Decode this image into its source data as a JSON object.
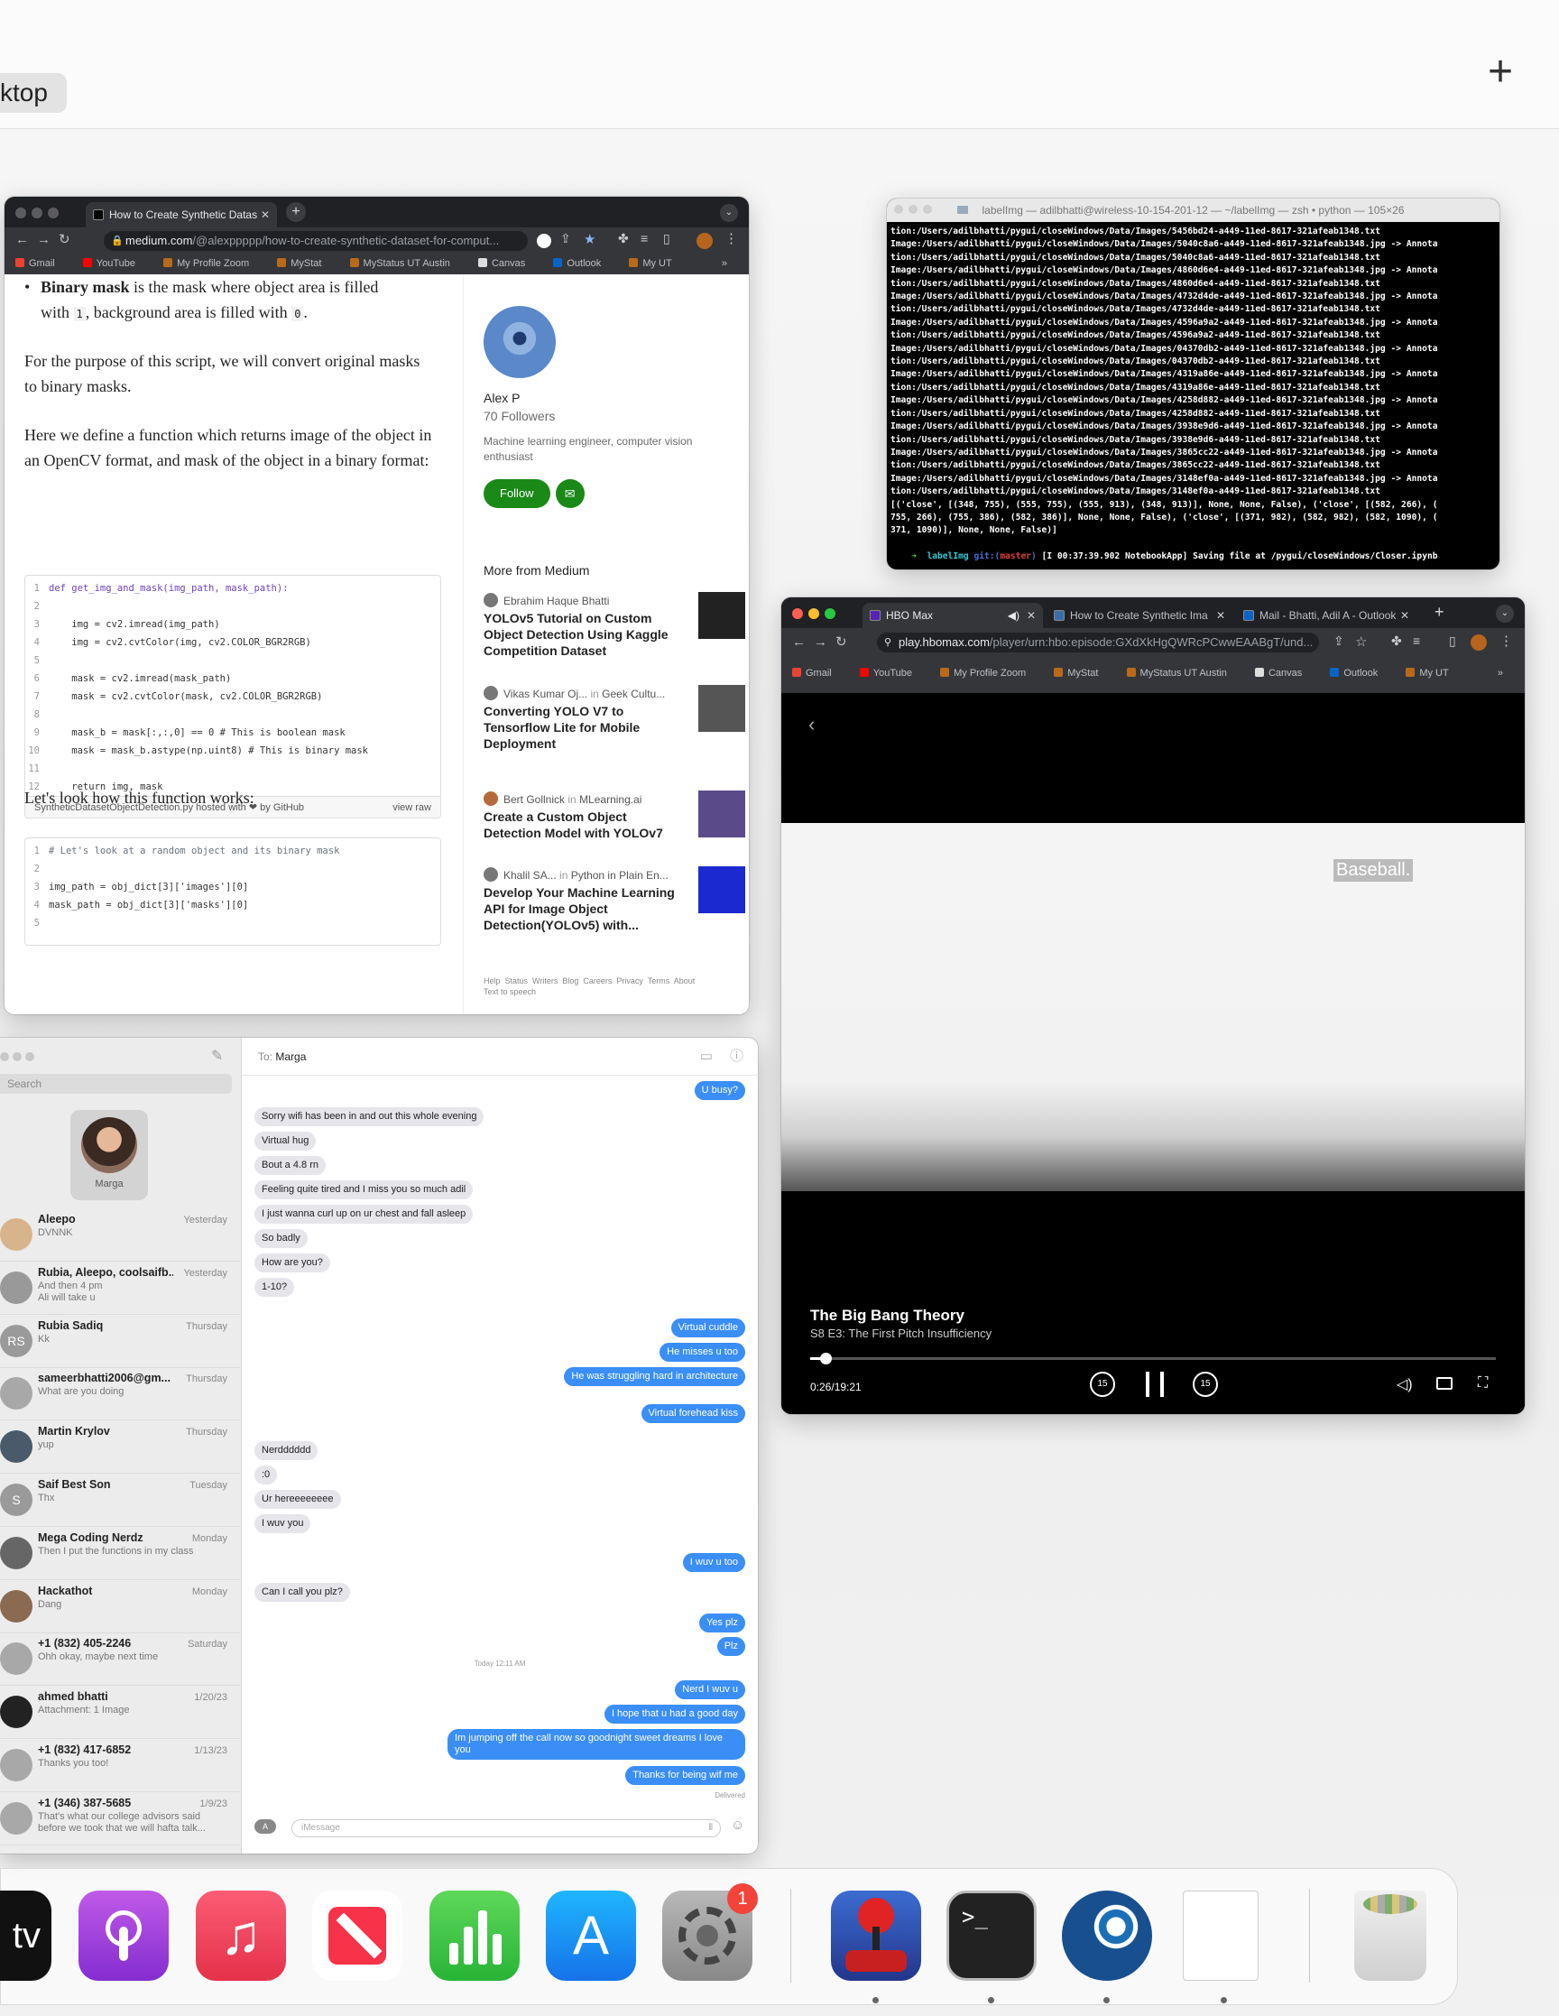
{
  "mission_control": {
    "desktop_label": "ktop",
    "add_space": "+"
  },
  "medium_window": {
    "tab_title": "How to Create Synthetic Datas",
    "url_main": "medium.com",
    "url_rest": "/@alexppppp/how-to-create-synthetic-dataset-for-comput...",
    "bookmarks": [
      "Gmail",
      "YouTube",
      "My Profile Zoom",
      "MyStat",
      "MyStatus UT Austin",
      "Canvas",
      "Outlook",
      "My UT"
    ],
    "bullet_bold": "Binary mask",
    "bullet_text1": " is the mask where object area is filled",
    "bullet_text2_a": "with ",
    "code_one": "1",
    "bullet_text2_b": ", background area is filled with ",
    "code_zero": "0",
    "para1": "For the purpose of this script, we will convert original masks to binary masks.",
    "para2": "Here we define a function which returns image of the object in an OpenCV format, and mask of the object in a binary format:",
    "code_block1": [
      {
        "n": "1",
        "t": "def get_img_and_mask(img_path, mask_path):"
      },
      {
        "n": "2",
        "t": ""
      },
      {
        "n": "3",
        "t": "    img = cv2.imread(img_path)"
      },
      {
        "n": "4",
        "t": "    img = cv2.cvtColor(img, cv2.COLOR_BGR2RGB)"
      },
      {
        "n": "5",
        "t": ""
      },
      {
        "n": "6",
        "t": "    mask = cv2.imread(mask_path)"
      },
      {
        "n": "7",
        "t": "    mask = cv2.cvtColor(mask, cv2.COLOR_BGR2RGB)"
      },
      {
        "n": "8",
        "t": ""
      },
      {
        "n": "9",
        "t": "    mask_b = mask[:,:,0] == 0 # This is boolean mask"
      },
      {
        "n": "10",
        "t": "    mask = mask_b.astype(np.uint8) # This is binary mask"
      },
      {
        "n": "11",
        "t": ""
      },
      {
        "n": "12",
        "t": "    return img, mask"
      }
    ],
    "gist_file": "SyntheticDatasetObjectDetection.py",
    "gist_hosted": " hosted with ❤ by ",
    "gist_github": "GitHub",
    "gist_view_raw": "view raw",
    "para3": "Let's look how this function works:",
    "code_block2": [
      {
        "n": "1",
        "t": "# Let's look at a random object and its binary mask"
      },
      {
        "n": "2",
        "t": ""
      },
      {
        "n": "3",
        "t": "img_path = obj_dict[3]['images'][0]"
      },
      {
        "n": "4",
        "t": "mask_path = obj_dict[3]['masks'][0]"
      },
      {
        "n": "5",
        "t": ""
      }
    ],
    "author_name": "Alex P",
    "author_followers": "70 Followers",
    "author_bio": "Machine learning engineer, computer vision enthusiast",
    "follow_label": "Follow",
    "more_heading": "More from Medium",
    "more": [
      {
        "author": "Ebrahim Haque Bhatti",
        "pub": "",
        "title": "YOLOv5 Tutorial on Custom Object Detection Using Kaggle Competition Dataset"
      },
      {
        "author": "Vikas Kumar Oj...",
        "pub": "Geek Cultu...",
        "title": "Converting YOLO V7 to Tensorflow Lite for Mobile Deployment"
      },
      {
        "author": "Bert Gollnick",
        "pub": "MLearning.ai",
        "title": "Create a Custom Object Detection Model with YOLOv7"
      },
      {
        "author": "Khalil SA...",
        "pub": "Python in Plain En...",
        "title": "Develop Your Machine Learning API for Image Object Detection(YOLOv5) with..."
      }
    ],
    "in_label": "in",
    "footer_links": "Help  Status  Writers  Blog  Careers  Privacy  Terms  About",
    "footer_links2": "Text to speech"
  },
  "terminal_window": {
    "title": "labelImg — adilbhatti@wireless-10-154-201-12 — ~/labelImg — zsh • python — 105×26",
    "lines": [
      "tion:/Users/adilbhatti/pygui/closeWindows/Data/Images/5456bd24-a449-11ed-8617-321afeab1348.txt",
      "Image:/Users/adilbhatti/pygui/closeWindows/Data/Images/5040c8a6-a449-11ed-8617-321afeab1348.jpg -> Annota",
      "tion:/Users/adilbhatti/pygui/closeWindows/Data/Images/5040c8a6-a449-11ed-8617-321afeab1348.txt",
      "Image:/Users/adilbhatti/pygui/closeWindows/Data/Images/4860d6e4-a449-11ed-8617-321afeab1348.jpg -> Annota",
      "tion:/Users/adilbhatti/pygui/closeWindows/Data/Images/4860d6e4-a449-11ed-8617-321afeab1348.txt",
      "Image:/Users/adilbhatti/pygui/closeWindows/Data/Images/4732d4de-a449-11ed-8617-321afeab1348.jpg -> Annota",
      "tion:/Users/adilbhatti/pygui/closeWindows/Data/Images/4732d4de-a449-11ed-8617-321afeab1348.txt",
      "Image:/Users/adilbhatti/pygui/closeWindows/Data/Images/4596a9a2-a449-11ed-8617-321afeab1348.jpg -> Annota",
      "tion:/Users/adilbhatti/pygui/closeWindows/Data/Images/4596a9a2-a449-11ed-8617-321afeab1348.txt",
      "Image:/Users/adilbhatti/pygui/closeWindows/Data/Images/04370db2-a449-11ed-8617-321afeab1348.jpg -> Annota",
      "tion:/Users/adilbhatti/pygui/closeWindows/Data/Images/04370db2-a449-11ed-8617-321afeab1348.txt",
      "Image:/Users/adilbhatti/pygui/closeWindows/Data/Images/4319a86e-a449-11ed-8617-321afeab1348.jpg -> Annota",
      "tion:/Users/adilbhatti/pygui/closeWindows/Data/Images/4319a86e-a449-11ed-8617-321afeab1348.txt",
      "Image:/Users/adilbhatti/pygui/closeWindows/Data/Images/4258d882-a449-11ed-8617-321afeab1348.jpg -> Annota",
      "tion:/Users/adilbhatti/pygui/closeWindows/Data/Images/4258d882-a449-11ed-8617-321afeab1348.txt",
      "Image:/Users/adilbhatti/pygui/closeWindows/Data/Images/3938e9d6-a449-11ed-8617-321afeab1348.jpg -> Annota",
      "tion:/Users/adilbhatti/pygui/closeWindows/Data/Images/3938e9d6-a449-11ed-8617-321afeab1348.txt",
      "Image:/Users/adilbhatti/pygui/closeWindows/Data/Images/3865cc22-a449-11ed-8617-321afeab1348.jpg -> Annota",
      "tion:/Users/adilbhatti/pygui/closeWindows/Data/Images/3865cc22-a449-11ed-8617-321afeab1348.txt",
      "Image:/Users/adilbhatti/pygui/closeWindows/Data/Images/3148ef0a-a449-11ed-8617-321afeab1348.jpg -> Annota",
      "tion:/Users/adilbhatti/pygui/closeWindows/Data/Images/3148ef0a-a449-11ed-8617-321afeab1348.txt",
      "[('close', [(348, 755), (555, 755), (555, 913), (348, 913)], None, None, False), ('close', [(582, 266), (",
      "755, 266), (755, 386), (582, 386)], None, None, False), ('close', [(371, 982), (582, 982), (582, 1090), (",
      "371, 1090)], None, None, False)]"
    ],
    "prompt_arrow": "➜",
    "prompt_dir": "labelImg",
    "prompt_git": "git:(",
    "prompt_branch": "master",
    "prompt_git_end": ")",
    "prompt_rest": "[I 00:37:39.902 NotebookApp] Saving file at /pygui/closeWindows/Closer.ipynb"
  },
  "hbo_window": {
    "tabs": [
      "HBO Max",
      "How to Create Synthetic Ima",
      "Mail - Bhatti, Adil A - Outlook"
    ],
    "url_main": "play.hbomax.com",
    "url_rest": "/player/urn:hbo:episode:GXdXkHgQWRcPCwwEAABgT/und...",
    "bookmarks": [
      "Gmail",
      "YouTube",
      "My Profile Zoom",
      "MyStat",
      "MyStatus UT Austin",
      "Canvas",
      "Outlook",
      "My UT"
    ],
    "subtitle_caption": "Baseball.",
    "show_title": "The Big Bang Theory",
    "episode": "S8 E3: The First Pitch Insufficiency",
    "time": "0:26/19:21",
    "progress": 0.022,
    "skip_back": "15",
    "skip_fwd": "15"
  },
  "messages_window": {
    "search_placeholder": "Search",
    "pinned_name": "Marga",
    "to_label": "To:",
    "to_name": "Marga",
    "conversations": [
      {
        "initials": "",
        "name": "Aleepo",
        "date": "Yesterday",
        "preview": "DVNNK",
        "preview2": ""
      },
      {
        "initials": "",
        "name": "Rubia, Aleepo, coolsaifb...",
        "date": "Yesterday",
        "preview": "And then 4 pm",
        "preview2": "Ali will take u"
      },
      {
        "initials": "RS",
        "name": "Rubia Sadiq",
        "date": "Thursday",
        "preview": "Kk",
        "preview2": ""
      },
      {
        "initials": "",
        "name": "sameerbhatti2006@gm...",
        "date": "Thursday",
        "preview": "What are you doing",
        "preview2": ""
      },
      {
        "initials": "",
        "name": "Martin Krylov",
        "date": "Thursday",
        "preview": "yup",
        "preview2": ""
      },
      {
        "initials": "S",
        "name": "Saif Best Son",
        "date": "Tuesday",
        "preview": "Thx",
        "preview2": ""
      },
      {
        "initials": "",
        "name": "Mega Coding Nerdz",
        "date": "Monday",
        "preview": "Then I put the functions in my class",
        "preview2": ""
      },
      {
        "initials": "",
        "name": "Hackathot",
        "date": "Monday",
        "preview": "Dang",
        "preview2": ""
      },
      {
        "initials": "",
        "name": "+1 (832) 405-2246",
        "date": "Saturday",
        "preview": "Ohh okay, maybe next time",
        "preview2": ""
      },
      {
        "initials": "",
        "name": "ahmed bhatti",
        "date": "1/20/23",
        "preview": "Attachment: 1 Image",
        "preview2": ""
      },
      {
        "initials": "",
        "name": "+1 (832) 417-6852",
        "date": "1/13/23",
        "preview": "Thanks you too!",
        "preview2": ""
      },
      {
        "initials": "",
        "name": "+1 (346) 387-5685",
        "date": "1/9/23",
        "preview": "That's what our college advisors said",
        "preview2": "before we took that we will hafta talk..."
      }
    ],
    "bubbles": [
      {
        "dir": "out",
        "text": "U busy?"
      },
      {
        "dir": "in",
        "text": "Sorry wifi has been in and out this whole evening"
      },
      {
        "dir": "in",
        "text": "Virtual hug"
      },
      {
        "dir": "in",
        "text": "Bout a 4.8 rn"
      },
      {
        "dir": "in",
        "text": "Feeling quite tired and I miss you so much adil"
      },
      {
        "dir": "in",
        "text": "I just wanna curl up on ur chest and fall asleep"
      },
      {
        "dir": "in",
        "text": "So badly"
      },
      {
        "dir": "in",
        "text": "How are you?"
      },
      {
        "dir": "in",
        "text": "1-10?"
      },
      {
        "dir": "out",
        "text": "Virtual cuddle"
      },
      {
        "dir": "out",
        "text": "He misses u too"
      },
      {
        "dir": "out",
        "text": "He was struggling hard in architecture"
      },
      {
        "dir": "out",
        "text": "Virtual forehead kiss"
      },
      {
        "dir": "in",
        "text": "Nerdddddd"
      },
      {
        "dir": "in",
        "text": ":0"
      },
      {
        "dir": "in",
        "text": "Ur hereeeeeeee"
      },
      {
        "dir": "in",
        "text": "I wuv you"
      },
      {
        "dir": "out",
        "text": "I wuv u too"
      },
      {
        "dir": "in",
        "text": "Can I call you plz?"
      },
      {
        "dir": "out",
        "text": "Yes plz"
      },
      {
        "dir": "out",
        "text": "Plz"
      },
      {
        "dir": "out",
        "text": "Nerd I wuv u"
      },
      {
        "dir": "out",
        "text": "I hope that u had a good day"
      },
      {
        "dir": "out",
        "text": "Im jumping off the call now so goodnight sweet dreams I love you"
      },
      {
        "dir": "out",
        "text": "Thanks for being wif me"
      }
    ],
    "timestamp": "Today 12:11 AM",
    "delivered": "Delivered",
    "input_placeholder": "iMessage"
  },
  "dock": {
    "apps": [
      "tv-icon",
      "podcasts-icon",
      "music-icon",
      "news-icon",
      "numbers-icon",
      "app-store-icon",
      "system-settings-icon",
      "joystick-app-icon",
      "terminal-icon",
      "steam-icon",
      "document-icon",
      "trash-icon"
    ],
    "tv_label": "tv",
    "settings_badge": "1",
    "terminal_glyph": ">_"
  },
  "colors": {
    "medium_green": "#1a8917",
    "imessage_blue": "#3a8ef6",
    "hbo_purple": "#5822b4"
  }
}
